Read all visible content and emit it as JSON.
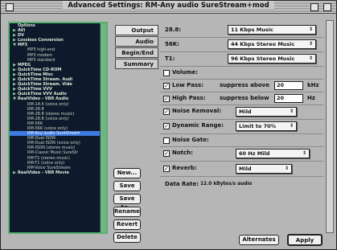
{
  "window": {
    "title": "Advanced Settings: RM-Any audio SureStream+mod"
  },
  "tree": {
    "items": [
      {
        "label": "Options",
        "level": 0,
        "tw": ""
      },
      {
        "label": "AVI",
        "level": 0,
        "tw": "▶"
      },
      {
        "label": "DV",
        "level": 0,
        "tw": "▶"
      },
      {
        "label": "Lossless Conversion",
        "level": 0,
        "tw": "▶"
      },
      {
        "label": "MP3",
        "level": 0,
        "tw": "▼"
      },
      {
        "label": "MP3 high-end",
        "level": 1,
        "tw": ""
      },
      {
        "label": "MP3 modem",
        "level": 1,
        "tw": ""
      },
      {
        "label": "MP3 standard",
        "level": 1,
        "tw": ""
      },
      {
        "label": "MPEG",
        "level": 0,
        "tw": "▶"
      },
      {
        "label": "QuickTime CD-ROM",
        "level": 0,
        "tw": "▶"
      },
      {
        "label": "QuickTime Misc",
        "level": 0,
        "tw": "▶"
      },
      {
        "label": "QuickTime Stream. Audi",
        "level": 0,
        "tw": "▶"
      },
      {
        "label": "QuickTime Stream. Vide",
        "level": 0,
        "tw": "▶"
      },
      {
        "label": "QuickTime VVV",
        "level": 0,
        "tw": "▶"
      },
      {
        "label": "QuickTime VVV Audio",
        "level": 0,
        "tw": "▶"
      },
      {
        "label": "RealVideo - VBR Audio",
        "level": 0,
        "tw": "▼"
      },
      {
        "label": "RM-14.4 (voice only)",
        "level": 1,
        "tw": ""
      },
      {
        "label": "RM-28.8",
        "level": 1,
        "tw": ""
      },
      {
        "label": "RM-28.8 (stereo music)",
        "level": 1,
        "tw": ""
      },
      {
        "label": "RM-28.8 (voice only)",
        "level": 1,
        "tw": ""
      },
      {
        "label": "RM-56K",
        "level": 1,
        "tw": ""
      },
      {
        "label": "RM-56K (voice only)",
        "level": 1,
        "tw": ""
      },
      {
        "label": "RM-Any audio SureStream",
        "level": 1,
        "tw": "",
        "selected": true
      },
      {
        "label": "RM-Dual ISDN",
        "level": 1,
        "tw": ""
      },
      {
        "label": "RM-Dual ISDN (voice only)",
        "level": 1,
        "tw": ""
      },
      {
        "label": "RM-ISDN (stereo music)",
        "level": 1,
        "tw": ""
      },
      {
        "label": "RM-Classic Music SureStr",
        "level": 1,
        "tw": ""
      },
      {
        "label": "RM-T1 (stereo music)",
        "level": 1,
        "tw": ""
      },
      {
        "label": "RM-T1 (voice only)",
        "level": 1,
        "tw": ""
      },
      {
        "label": "RM-Voice SureStream",
        "level": 1,
        "tw": ""
      },
      {
        "label": "RealVideo - VBR Movie",
        "level": 0,
        "tw": "▶"
      }
    ]
  },
  "tabs": [
    {
      "label": "Output"
    },
    {
      "label": "Audio"
    },
    {
      "label": "Begin/End"
    },
    {
      "label": "Summary"
    }
  ],
  "buttons": {
    "new": "New...",
    "save": "Save",
    "save_as": "Save As...",
    "rename": "Rename",
    "revert": "Revert",
    "delete": "Delete",
    "alternates": "Alternates",
    "apply": "Apply"
  },
  "settings": {
    "r288_label": "28.8:",
    "r288_value": "11 Kbps Music",
    "r56k_label": "56K:",
    "r56k_value": "44 Kbps Stereo Music",
    "t1_label": "T1:",
    "t1_value": "96 Kbps Stereo Music",
    "volume_label": "Volume:",
    "lowpass_label": "Low Pass:",
    "lowpass_mode": "suppress above",
    "lowpass_value": "20",
    "lowpass_unit": "kHz",
    "highpass_label": "High Pass:",
    "highpass_mode": "suppress below",
    "highpass_value": "20",
    "highpass_unit": "Hz",
    "noise_removal_label": "Noise Removal:",
    "noise_removal_value": "Mild",
    "dynamic_range_label": "Dynamic Range:",
    "dynamic_range_value": "Limit to 70%",
    "noise_gate_label": "Noise Gate:",
    "notch_label": "Notch:",
    "notch_value": "60 Hz Mild",
    "reverb_label": "Reverb:",
    "reverb_value": "Mild",
    "data_rate_label": "Data Rate:",
    "data_rate_value": "12.0 kBytes/s audio"
  }
}
